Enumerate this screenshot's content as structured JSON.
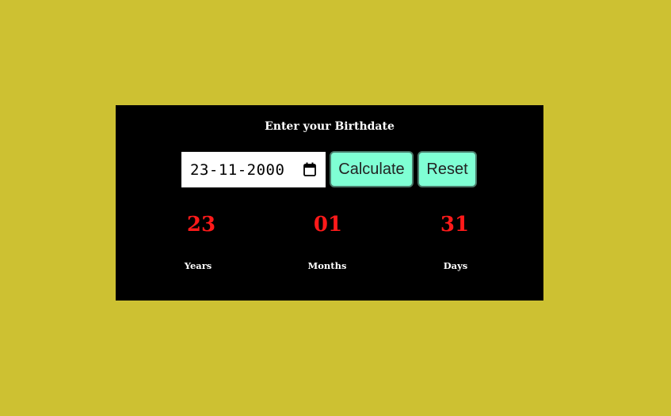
{
  "heading": "Enter your Birthdate",
  "date_input": {
    "value": "23-11-2000",
    "icon": "calendar-icon"
  },
  "buttons": {
    "calculate": "Calculate",
    "reset": "Reset"
  },
  "results": {
    "years": {
      "value": "23",
      "label": "Years"
    },
    "months": {
      "value": "01",
      "label": "Months"
    },
    "days": {
      "value": "31",
      "label": "Days"
    }
  },
  "colors": {
    "background": "#cdc132",
    "card": "#000000",
    "button": "#7fffd4",
    "result_value": "#ff1a1a",
    "label": "#ffffff"
  }
}
